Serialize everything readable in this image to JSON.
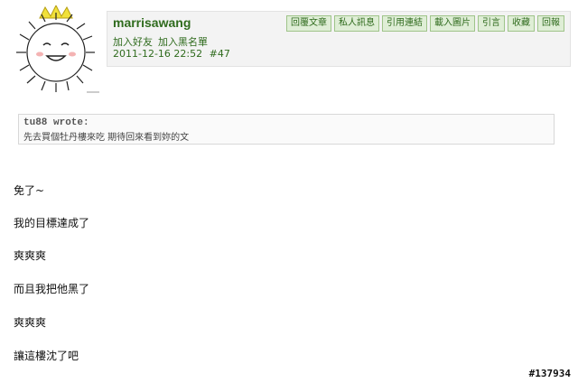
{
  "post": {
    "username": "marrisawang",
    "add_friend": "加入好友",
    "add_blacklist": "加入黑名單",
    "datetime": "2011-12-16 22:52",
    "floor": "#47",
    "actions": [
      "回覆文章",
      "私人訊息",
      "引用連結",
      "載入圖片",
      "引言",
      "收藏",
      "回報"
    ]
  },
  "quote": {
    "author": "tu88 wrote:",
    "text": "先去買個牡丹樓來吃 期待回來看到妳的文"
  },
  "content_lines": [
    "免了~",
    "我的目標達成了",
    "爽爽爽",
    "而且我把他黑了",
    "爽爽爽",
    "讓這樓沈了吧"
  ],
  "post_id_label": "#137934",
  "colors": {
    "accent_green": "#2f6b1d",
    "button_bg": "#dfeed6",
    "header_bg": "#f3f3f3"
  }
}
